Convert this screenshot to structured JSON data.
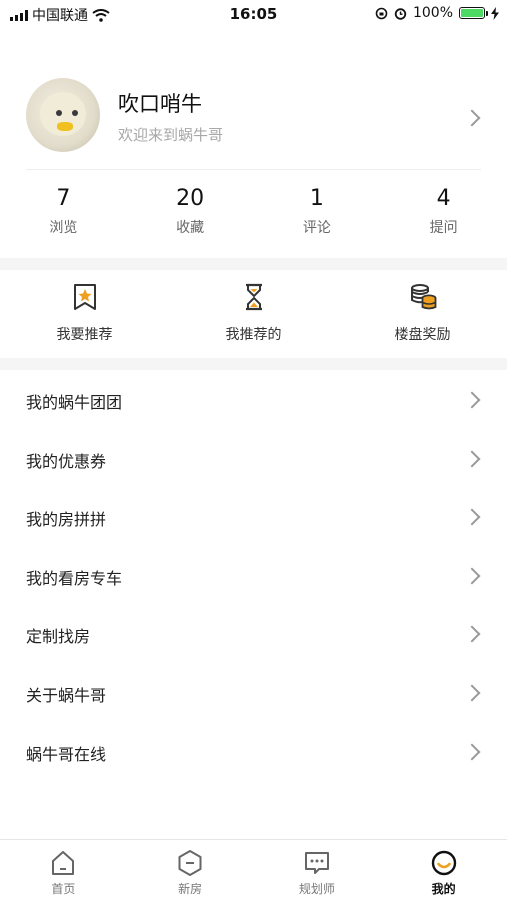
{
  "status_bar": {
    "carrier": "中国联通",
    "time": "16:05",
    "battery": "100%",
    "battery_level": 1.0
  },
  "profile": {
    "name": "吹口哨牛",
    "subtitle": "欢迎来到蜗牛哥"
  },
  "stats": [
    {
      "value": "7",
      "label": "浏览"
    },
    {
      "value": "20",
      "label": "收藏"
    },
    {
      "value": "1",
      "label": "评论"
    },
    {
      "value": "4",
      "label": "提问"
    }
  ],
  "actions": [
    {
      "label": "我要推荐",
      "icon": "recommend-star-icon"
    },
    {
      "label": "我推荐的",
      "icon": "hourglass-icon"
    },
    {
      "label": "楼盘奖励",
      "icon": "coins-icon"
    }
  ],
  "menu": [
    {
      "label": "我的蜗牛团团"
    },
    {
      "label": "我的优惠券"
    },
    {
      "label": "我的房拼拼"
    },
    {
      "label": "我的看房专车"
    },
    {
      "label": "定制找房"
    },
    {
      "label": "关于蜗牛哥"
    },
    {
      "label": "蜗牛哥在线"
    }
  ],
  "tabbar": {
    "active": "我的",
    "tabs": [
      {
        "label": "首页",
        "icon": "home-icon"
      },
      {
        "label": "新房",
        "icon": "hexagon-icon"
      },
      {
        "label": "规划师",
        "icon": "chat-bubble-icon"
      },
      {
        "label": "我的",
        "icon": "smile-face-icon"
      }
    ]
  },
  "colors": {
    "accent": "#f0a020",
    "icon_dark": "#333333",
    "muted": "#a8a8a8",
    "section_gap": "#f5f5f5"
  }
}
